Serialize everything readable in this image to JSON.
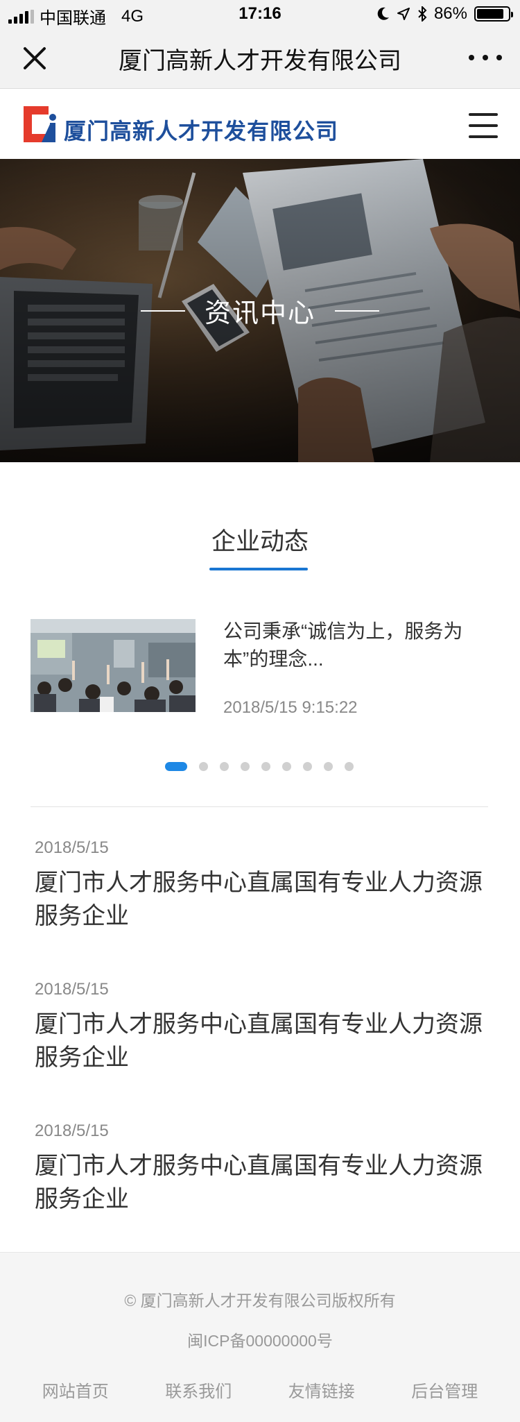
{
  "status_bar": {
    "carrier": "中国联通",
    "network": "4G",
    "time": "17:16",
    "battery": "86%",
    "battery_level": 0.86
  },
  "nav_bar": {
    "title": "厦门高新人才开发有限公司"
  },
  "site_header": {
    "logo_text": "厦门高新人才开发有限公司",
    "logo_colors": {
      "red": "#e53b2c",
      "blue": "#1e4f9c"
    }
  },
  "banner": {
    "title": "资讯中心"
  },
  "section": {
    "title": "企业动态",
    "accent": "#1976d2"
  },
  "featured_news": {
    "summary": "公司秉承“诚信为上，服务为本”的理念...",
    "time": "2018/5/15  9:15:22"
  },
  "carousel": {
    "count": 9,
    "active_index": 0
  },
  "news_list": [
    {
      "date": "2018/5/15",
      "headline": "厦门市人才服务中心直属国有专业人力资源服务企业"
    },
    {
      "date": "2018/5/15",
      "headline": "厦门市人才服务中心直属国有专业人力资源服务企业"
    },
    {
      "date": "2018/5/15",
      "headline": "厦门市人才服务中心直属国有专业人力资源服务企业"
    }
  ],
  "footer": {
    "copyright": "© 厦门高新人才开发有限公司版权所有",
    "icp": "闽ICP备00000000号",
    "links": [
      "网站首页",
      "联系我们",
      "友情链接",
      "后台管理"
    ]
  }
}
